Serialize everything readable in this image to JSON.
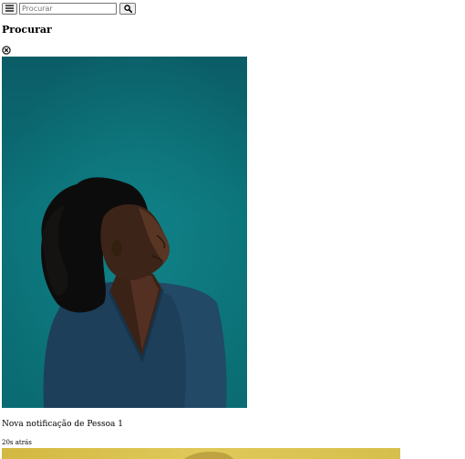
{
  "toolbar": {
    "menu_icon": "hamburger-icon",
    "search_icon": "magnifier-icon"
  },
  "search": {
    "placeholder": "Procurar",
    "value": ""
  },
  "page": {
    "heading": "Procurar"
  },
  "notifications": [
    {
      "image": "portrait of a woman looking upward on teal background",
      "text": "Nova notificação de Pessoa 1",
      "time": "20s atrás"
    },
    {
      "image": "yellow toned photo"
    }
  ],
  "colors": {
    "teal_background": "#0b6c74",
    "sweater": "#1d3f5a",
    "yellow_photo": "#d8c24a"
  }
}
